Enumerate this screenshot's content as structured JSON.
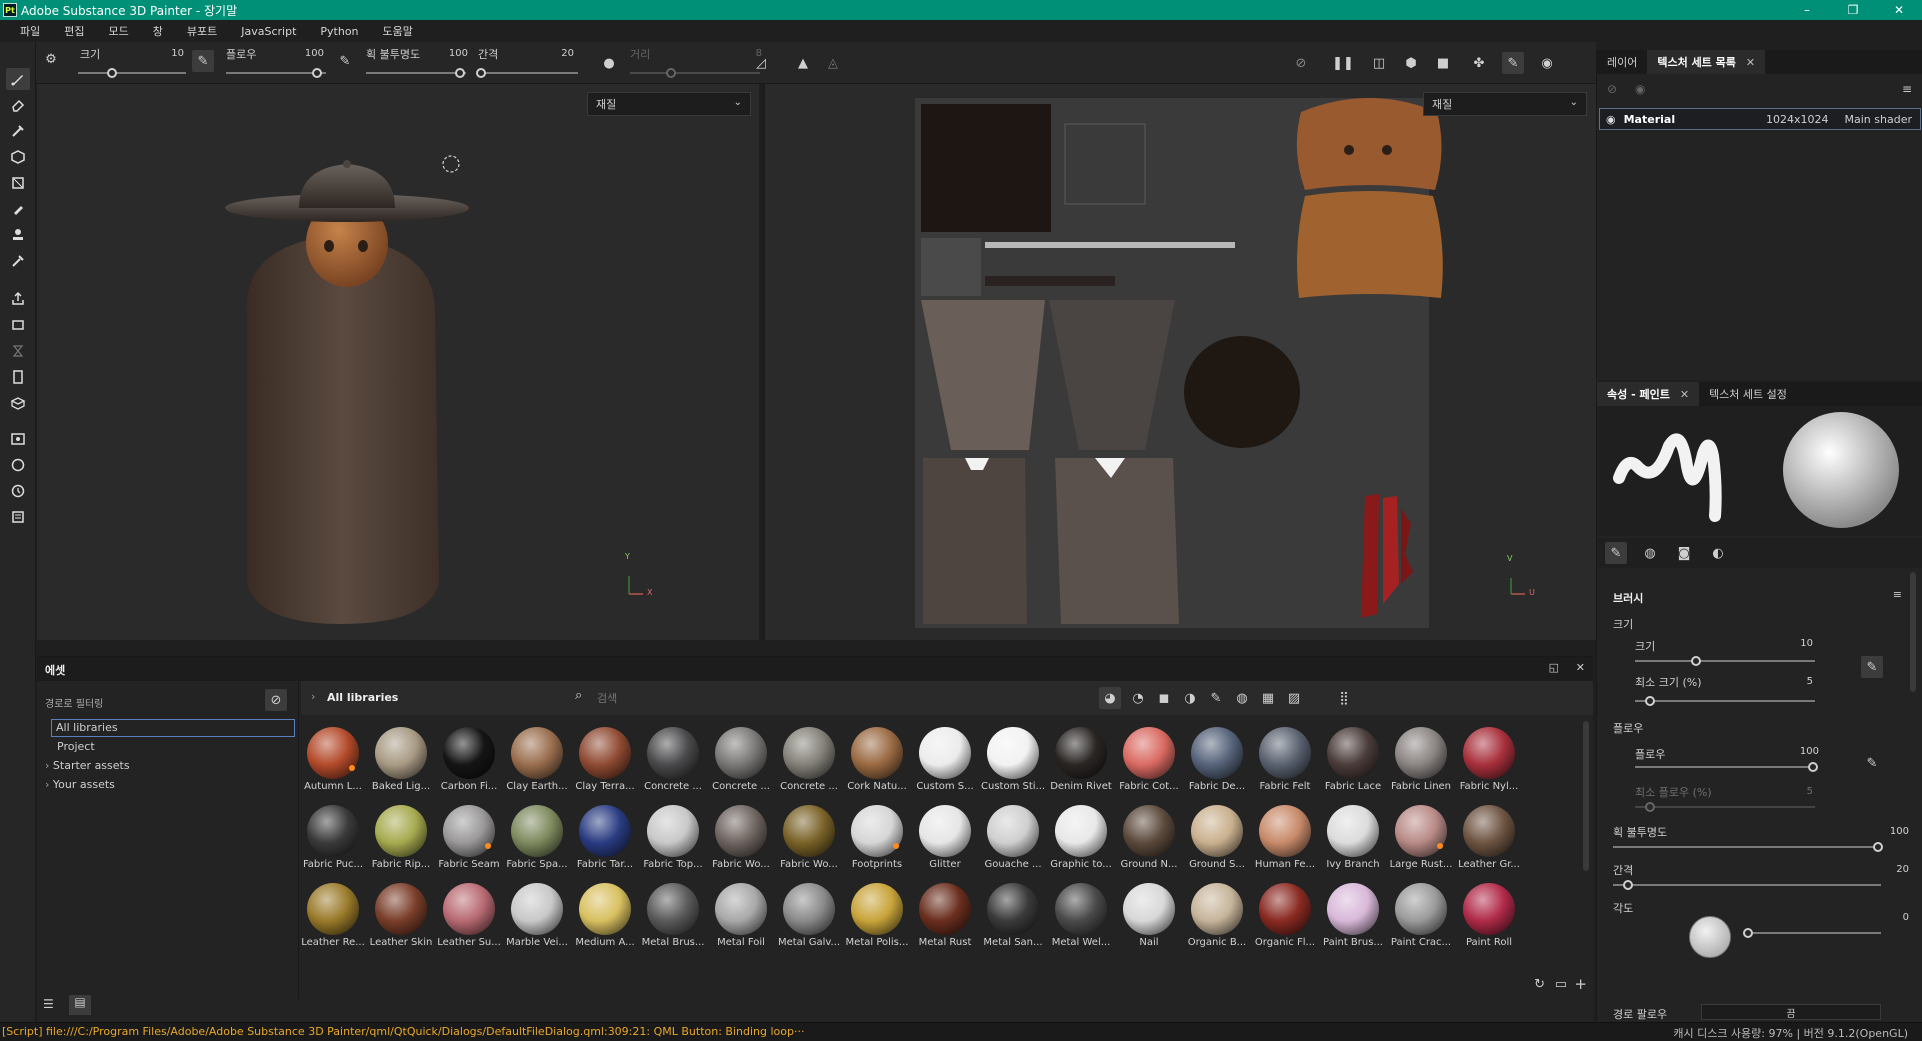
{
  "window": {
    "title": "Adobe Substance 3D Painter - 장기말",
    "app_badge": "Pt",
    "controls": [
      "–",
      "❐",
      "✕"
    ]
  },
  "menu": [
    "파일",
    "편집",
    "모드",
    "창",
    "뷰포트",
    "JavaScript",
    "Python",
    "도움말"
  ],
  "tool_options": {
    "size_label": "크기",
    "size_value": "10",
    "flow_label": "플로우",
    "flow_value": "100",
    "opacity_label": "획 불투명도",
    "opacity_value": "100",
    "spacing_label": "간격",
    "spacing_value": "20",
    "distance_label": "거리",
    "distance_value": "8"
  },
  "viewport3d": {
    "material_select": "재질",
    "axis_x": "X",
    "axis_y": "Y"
  },
  "viewport2d": {
    "material_select": "재질",
    "axis_u": "U",
    "axis_v": "V"
  },
  "texset_panel": {
    "tab_layers": "레이어",
    "tab_texset_list": "텍스처 세트 목록",
    "tab_close": "✕",
    "row": {
      "name": "Material",
      "resolution": "1024x1024",
      "shader": "Main shader"
    }
  },
  "properties_panel": {
    "tab_properties": "속성 - 페인트",
    "tab_close": "✕",
    "tab_texset_settings": "텍스처 세트 설정",
    "brush_title": "브러시",
    "size_group": "크기",
    "size_label": "크기",
    "size_value": "10",
    "min_size_label": "최소 크기 (%)",
    "min_size_value": "5",
    "flow_group": "플로우",
    "flow_label": "플로우",
    "flow_value": "100",
    "min_flow_label": "최소 플로우 (%)",
    "min_flow_value": "5",
    "opacity_label": "획 불투명도",
    "opacity_value": "100",
    "spacing_label": "간격",
    "spacing_value": "20",
    "angle_label": "각도",
    "angle_value": "0",
    "path_label": "경로 팔로우",
    "path_value": "끔"
  },
  "assets": {
    "title": "에셋",
    "path_filter": "경로로 필터링",
    "tree": [
      "All libraries",
      "Project",
      "Starter assets",
      "Your assets"
    ],
    "breadcrumb": "All libraries",
    "search_placeholder": "검색",
    "items": [
      {
        "label": "Autumn L...",
        "color": "#b34a2a"
      },
      {
        "label": "Baked Lig...",
        "color": "#a89a84"
      },
      {
        "label": "Carbon Fi...",
        "color": "#151515"
      },
      {
        "label": "Clay Earth...",
        "color": "#9a6e4e"
      },
      {
        "label": "Clay Terra...",
        "color": "#8f4a32"
      },
      {
        "label": "Concrete ...",
        "color": "#4a4a4c"
      },
      {
        "label": "Concrete ...",
        "color": "#7a7876"
      },
      {
        "label": "Concrete ...",
        "color": "#838078"
      },
      {
        "label": "Cork Natu...",
        "color": "#9a6a42"
      },
      {
        "label": "Custom S...",
        "color": "#ececec"
      },
      {
        "label": "Custom Sti...",
        "color": "#f2f2f2"
      },
      {
        "label": "Denim Rivet",
        "color": "#2a2624"
      },
      {
        "label": "Fabric Cot...",
        "color": "#d96a62"
      },
      {
        "label": "Fabric De...",
        "color": "#56637a"
      },
      {
        "label": "Fabric Felt",
        "color": "#5a6270"
      },
      {
        "label": "Fabric Lace",
        "color": "#4a3c3a"
      },
      {
        "label": "Fabric Linen",
        "color": "#8a8482"
      },
      {
        "label": "Fabric Nyl...",
        "color": "#a8303c"
      },
      {
        "label": "Fabric Puc...",
        "color": "#3a3a3a"
      },
      {
        "label": "Fabric Rip...",
        "color": "#a6aa4e"
      },
      {
        "label": "Fabric Seam",
        "color": "#9a9898"
      },
      {
        "label": "Fabric Spa...",
        "color": "#7e8a5e"
      },
      {
        "label": "Fabric Tar...",
        "color": "#2a3c82"
      },
      {
        "label": "Fabric Top...",
        "color": "#c8c8c8"
      },
      {
        "label": "Fabric Wo...",
        "color": "#6e6460"
      },
      {
        "label": "Fabric Wo...",
        "color": "#7a6228"
      },
      {
        "label": "Footprints",
        "color": "#d6d6d6"
      },
      {
        "label": "Glitter",
        "color": "#e6e6e6"
      },
      {
        "label": "Gouache ...",
        "color": "#cfcfcf"
      },
      {
        "label": "Graphic to...",
        "color": "#e8e8e8"
      },
      {
        "label": "Ground N...",
        "color": "#5c4a3c"
      },
      {
        "label": "Ground S...",
        "color": "#c9b08e"
      },
      {
        "label": "Human Fe...",
        "color": "#c88a6a"
      },
      {
        "label": "Ivy Branch",
        "color": "#dcdcdc"
      },
      {
        "label": "Large Rust...",
        "color": "#b88a86"
      },
      {
        "label": "Leather Gr...",
        "color": "#6e5442"
      },
      {
        "label": "Leather Re...",
        "color": "#9a7a2a"
      },
      {
        "label": "Leather Skin",
        "color": "#7a3e2a"
      },
      {
        "label": "Leather Su...",
        "color": "#b86a72"
      },
      {
        "label": "Marble Vei...",
        "color": "#c8c8c8"
      },
      {
        "label": "Medium A...",
        "color": "#d8c060"
      },
      {
        "label": "Metal Brus...",
        "color": "#5a5a5a"
      },
      {
        "label": "Metal Foil",
        "color": "#a8a8a8"
      },
      {
        "label": "Metal Galv...",
        "color": "#8a8a8a"
      },
      {
        "label": "Metal Polis...",
        "color": "#c8a43a"
      },
      {
        "label": "Metal Rust",
        "color": "#6a2e1e"
      },
      {
        "label": "Metal San...",
        "color": "#3a3a3a"
      },
      {
        "label": "Metal Wel...",
        "color": "#4a4a4a"
      },
      {
        "label": "Nail",
        "color": "#d8d8d8"
      },
      {
        "label": "Organic B...",
        "color": "#c6b49a"
      },
      {
        "label": "Organic Fl...",
        "color": "#8a2a22"
      },
      {
        "label": "Paint Brus...",
        "color": "#d8b8d8"
      },
      {
        "label": "Paint Crac...",
        "color": "#9a9a9a"
      },
      {
        "label": "Paint Roll",
        "color": "#b02a48"
      }
    ],
    "badge_indices": [
      0,
      20,
      26,
      34
    ]
  },
  "status": {
    "message": "[Script] file:///C:/Program Files/Adobe/Adobe Substance 3D Painter/qml/QtQuick/Dialogs/DefaultFileDialog.qml:309:21: QML Button: Binding loop···",
    "cache": "캐시 디스크 사용량:   97% | 버전 9.1.2(OpenGL)"
  },
  "colors": {
    "titlebar": "#009078",
    "status_message": "#e8a82a",
    "accent_blue": "#5b6f8a"
  }
}
